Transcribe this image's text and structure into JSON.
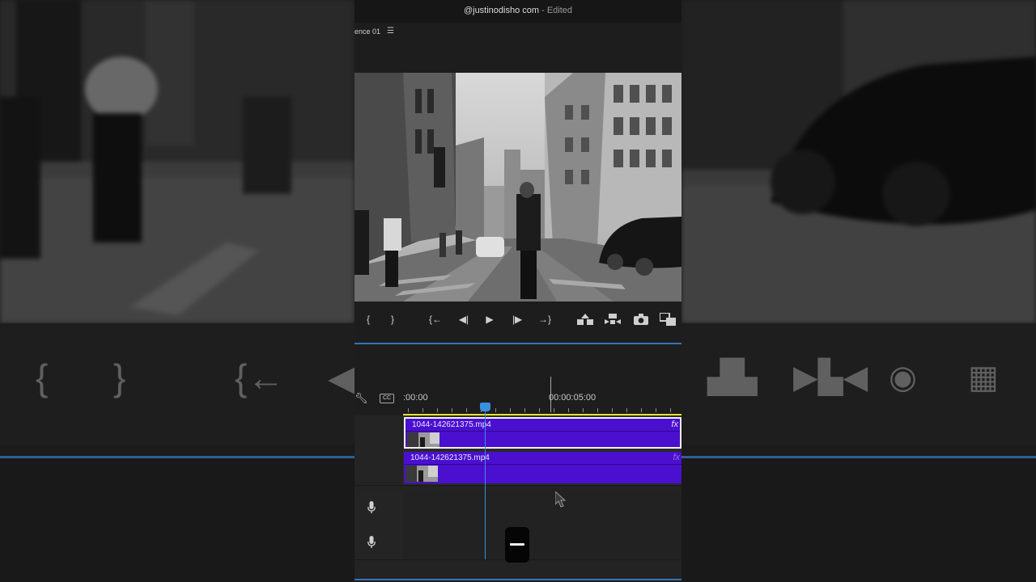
{
  "window": {
    "title": "@justinodisho com",
    "title_suffix": "- Edited"
  },
  "program_monitor": {
    "tab_label": "ence 01",
    "menu_icon": "hamburger-icon"
  },
  "transport_controls": [
    {
      "icon": "mark-in-icon",
      "glyph": "{"
    },
    {
      "icon": "mark-out-icon",
      "glyph": "}"
    },
    {
      "icon": "go-to-in-icon",
      "glyph": "{←"
    },
    {
      "icon": "step-back-icon",
      "glyph": "◀|"
    },
    {
      "icon": "play-icon",
      "glyph": "▶"
    },
    {
      "icon": "step-forward-icon",
      "glyph": "|▶"
    },
    {
      "icon": "go-to-out-icon",
      "glyph": "→}"
    },
    {
      "icon": "lift-icon",
      "glyph": "lift"
    },
    {
      "icon": "extract-icon",
      "glyph": "extract"
    },
    {
      "icon": "export-frame-camera-icon",
      "glyph": "camera"
    },
    {
      "icon": "comparison-view-icon",
      "glyph": "compare"
    }
  ],
  "timeline": {
    "timecode_left": ":00:00",
    "timecode_right": "00:00:05:00",
    "tools": {
      "wrench": "wrench-icon",
      "captions": "CC"
    },
    "video_clips": [
      {
        "name": "1044-142621375.mp4",
        "fx": "fx",
        "selected": true
      },
      {
        "name": "1044-142621375.mp4",
        "fx": "fx",
        "selected": false
      }
    ],
    "audio_tracks": [
      {
        "icon": "microphone-icon"
      },
      {
        "icon": "microphone-icon"
      }
    ]
  },
  "overlay": {
    "key_icon": "spacebar-key-icon"
  },
  "colors": {
    "clip": "#4b0fd0",
    "playhead": "#3a8fe0",
    "work_area": "#e4e430",
    "accent_line": "#3873b5"
  }
}
